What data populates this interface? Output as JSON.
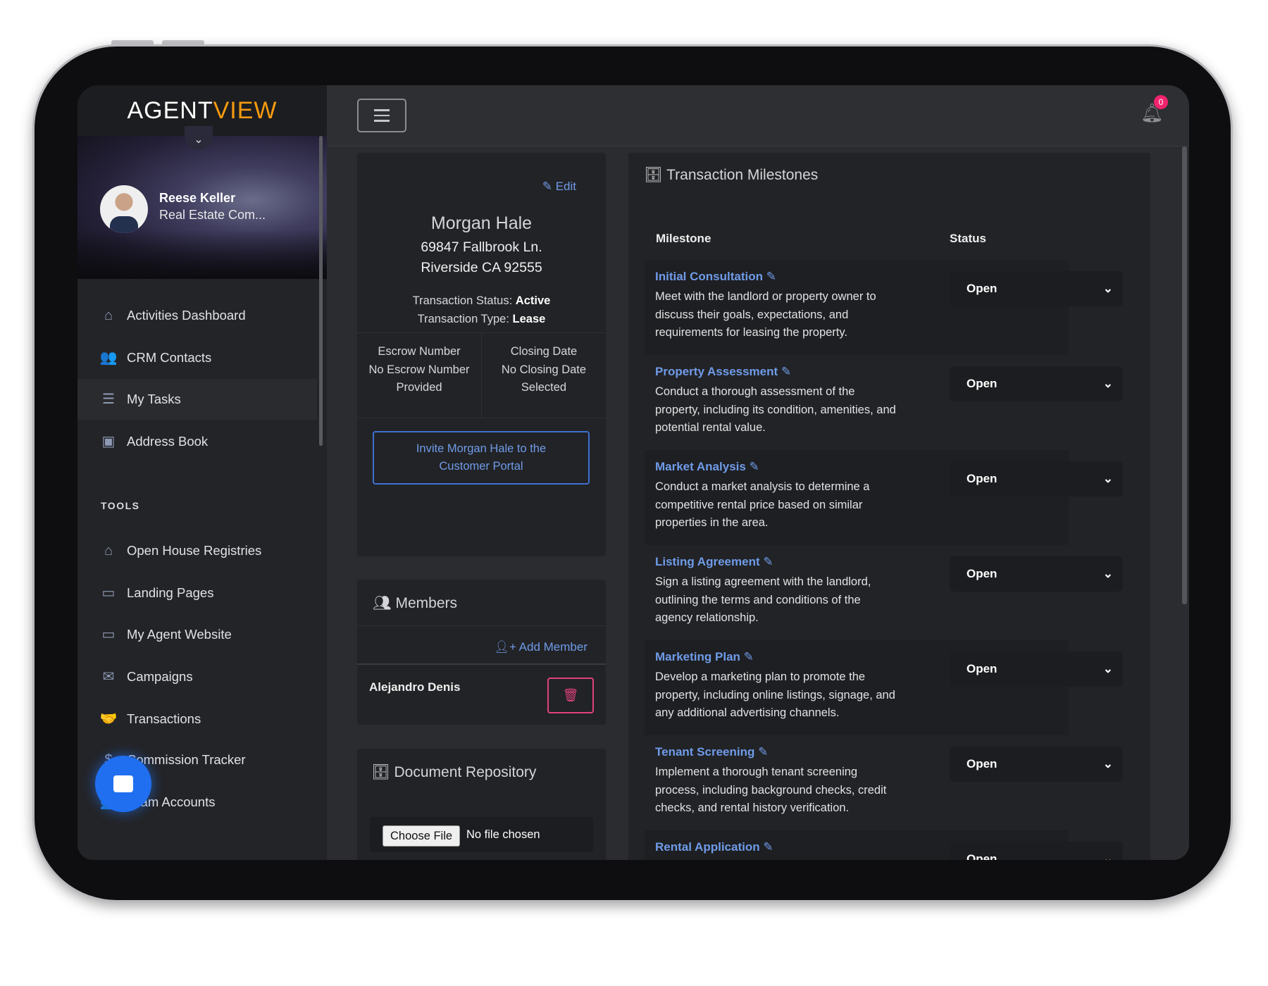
{
  "brand": {
    "logo_part1": "AGENT",
    "logo_part2": "VIEW",
    "accent": "#f59a10"
  },
  "user": {
    "name": "Reese Keller",
    "role": "Real Estate Com..."
  },
  "sidebar": {
    "items": [
      {
        "label": "Activities Dashboard",
        "icon": "home-icon",
        "glyph": "⌂"
      },
      {
        "label": "CRM Contacts",
        "icon": "users-icon",
        "glyph": "👥"
      },
      {
        "label": "My Tasks",
        "icon": "task-list-icon",
        "glyph": "☰",
        "active": true
      },
      {
        "label": "Address Book",
        "icon": "address-book-icon",
        "glyph": "▣"
      }
    ],
    "tools_label": "TOOLS",
    "tools": [
      {
        "label": "Open House Registries",
        "icon": "open-house-icon",
        "glyph": "⌂"
      },
      {
        "label": "Landing Pages",
        "icon": "landing-page-icon",
        "glyph": "▭"
      },
      {
        "label": "My Agent Website",
        "icon": "monitor-icon",
        "glyph": "▭"
      },
      {
        "label": "Campaigns",
        "icon": "campaign-icon",
        "glyph": "✉"
      },
      {
        "label": "Transactions",
        "icon": "handshake-icon",
        "glyph": "🤝"
      },
      {
        "label": "Commission Tracker",
        "icon": "commission-icon",
        "glyph": "$"
      },
      {
        "label": "Team Accounts",
        "icon": "team-icon",
        "glyph": "👥"
      }
    ]
  },
  "topbar": {
    "notification_count": "0"
  },
  "contact": {
    "edit_label": "Edit",
    "name": "Morgan Hale",
    "address_line1": "69847 Fallbrook Ln.",
    "address_line2": "Riverside CA 92555",
    "status_label": "Transaction Status:",
    "status_value": "Active",
    "type_label": "Transaction Type:",
    "type_value": "Lease",
    "escrow_label": "Escrow Number",
    "escrow_value": "No Escrow Number Provided",
    "closing_label": "Closing Date",
    "closing_value": "No Closing Date Selected",
    "invite_label": "Invite Morgan Hale to the Customer Portal"
  },
  "members": {
    "title": "Members",
    "add_label": "Add Member",
    "list": [
      {
        "name": "Alejandro Denis"
      }
    ]
  },
  "documents": {
    "title": "Document Repository",
    "choose_file": "Choose File",
    "no_file": "No file chosen"
  },
  "milestones": {
    "title": "Transaction Milestones",
    "col_milestone": "Milestone",
    "col_status": "Status",
    "rows": [
      {
        "title": "Initial Consultation",
        "desc": "Meet with the landlord or property owner to discuss their goals, expectations, and requirements for leasing the property.",
        "status": "Open"
      },
      {
        "title": "Property Assessment",
        "desc": "Conduct a thorough assessment of the property, including its condition, amenities, and potential rental value.",
        "status": "Open"
      },
      {
        "title": "Market Analysis",
        "desc": "Conduct a market analysis to determine a competitive rental price based on similar properties in the area.",
        "status": "Open"
      },
      {
        "title": "Listing Agreement",
        "desc": "Sign a listing agreement with the landlord, outlining the terms and conditions of the agency relationship.",
        "status": "Open"
      },
      {
        "title": "Marketing Plan",
        "desc": "Develop a marketing plan to promote the property, including online listings, signage, and any additional advertising channels.",
        "status": "Open"
      },
      {
        "title": "Tenant Screening",
        "desc": "Implement a thorough tenant screening process, including background checks, credit checks, and rental history verification.",
        "status": "Open"
      },
      {
        "title": "Rental Application",
        "desc": "",
        "status": "Open"
      }
    ]
  },
  "colors": {
    "link": "#6f9be8",
    "danger": "#e0427a",
    "primary": "#1f6ff0"
  }
}
